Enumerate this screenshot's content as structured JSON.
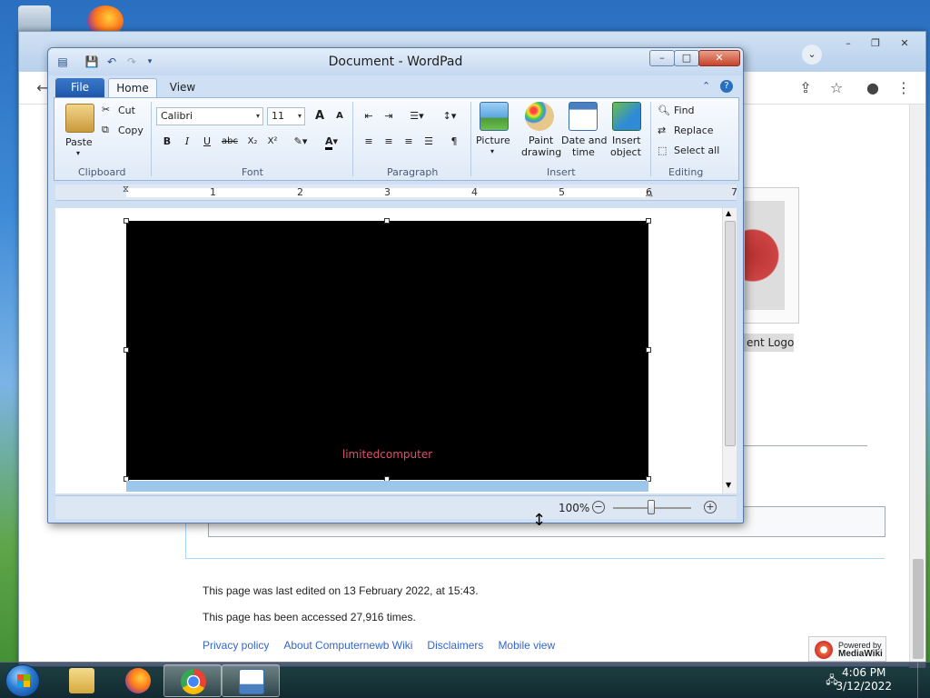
{
  "wordpad": {
    "title": "Document - WordPad",
    "tabs": {
      "file": "File",
      "home": "Home",
      "view": "View"
    },
    "clipboard": {
      "paste": "Paste",
      "cut": "Cut",
      "copy": "Copy",
      "label": "Clipboard"
    },
    "font": {
      "family": "Calibri",
      "size": "11",
      "label": "Font"
    },
    "paragraph": {
      "label": "Paragraph"
    },
    "insert": {
      "picture": "Picture",
      "paint_1": "Paint",
      "paint_2": "drawing",
      "datetime_1": "Date and",
      "datetime_2": "time",
      "object_1": "Insert",
      "object_2": "object",
      "label": "Insert"
    },
    "editing": {
      "find": "Find",
      "replace": "Replace",
      "select_all": "Select all",
      "label": "Editing"
    },
    "ruler": [
      "1",
      "2",
      "3",
      "4",
      "5",
      "6",
      "7"
    ],
    "image_text": "limitedcomputer",
    "zoom": "100%",
    "window_controls": {
      "minimize": "–",
      "maximize": "□",
      "close": "✕"
    },
    "format_buttons": {
      "bold": "B",
      "italic": "I",
      "underline": "U",
      "strike": "abc",
      "sub": "X₂",
      "sup": "X²",
      "grow": "A",
      "shrink": "A",
      "color": "A"
    }
  },
  "browser": {
    "logo_caption": "ent Logo",
    "category_items": [],
    "last_edited": "This page was last edited on 13 February 2022, at 15:43.",
    "accessed": "This page has been accessed 27,916 times.",
    "footer_links": [
      "Privacy policy",
      "About Computernewb Wiki",
      "Disclaimers",
      "Mobile view"
    ],
    "badge_1": "Powered by",
    "badge_2": "MediaWiki"
  },
  "taskbar": {
    "time": "4:06 PM",
    "date": "3/12/2022"
  },
  "colors": {
    "accent": "#1e56a8",
    "link": "#3366cc",
    "image_text": "#e0506a"
  }
}
